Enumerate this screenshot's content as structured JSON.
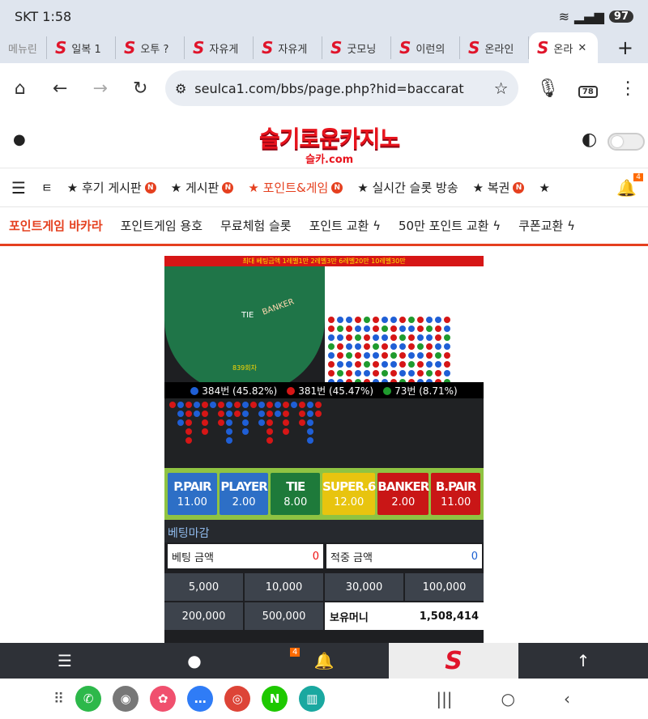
{
  "status": {
    "time": "SKT 1:58",
    "battery": "97"
  },
  "tabs": [
    {
      "label": "메뉴린"
    },
    {
      "label": "일복 1"
    },
    {
      "label": "오투 ?"
    },
    {
      "label": "자유게"
    },
    {
      "label": "자유게"
    },
    {
      "label": "굿모닝"
    },
    {
      "label": "이런의"
    },
    {
      "label": "온라인"
    },
    {
      "label": "온라"
    }
  ],
  "browser": {
    "url": "seulca1.com/bbs/page.php?hid=baccarat",
    "tab_count": "78"
  },
  "site": {
    "logo_main": "슬기로운카지노",
    "logo_sub": "슬카.com"
  },
  "menu1": [
    {
      "label": "ㅌ"
    },
    {
      "label": "★ 후기 게시판"
    },
    {
      "label": "★ 게시판"
    },
    {
      "label": "★ 포인트&게임"
    },
    {
      "label": "★ 실시간 슬롯 방송"
    },
    {
      "label": "★ 복권"
    },
    {
      "label": "★"
    }
  ],
  "bell_count": "4",
  "menu2": [
    {
      "label": "포인트게임 바카라"
    },
    {
      "label": "포인트게임 용호"
    },
    {
      "label": "무료체험 슬롯"
    },
    {
      "label": "포인트 교환 ϟ"
    },
    {
      "label": "50만 포인트 교환 ϟ"
    },
    {
      "label": "쿠폰교환 ϟ"
    }
  ],
  "game": {
    "banner": "최대 베팅금액   1레벨1만 2레벨3만 6레벨20만 10레벨30만",
    "table_banker": "BANKER",
    "table_tie": "TIE",
    "round_label": "839회차",
    "counts": [
      {
        "label": "384번 (45.82%)",
        "color": "#1f5fd6"
      },
      {
        "label": "381번 (45.47%)",
        "color": "#d61616"
      },
      {
        "label": "73번 (8.71%)",
        "color": "#1f9b2e"
      }
    ],
    "bets": [
      {
        "name": "P.PAIR",
        "odds": "11.00",
        "color": "#2d6fc6"
      },
      {
        "name": "PLAYER",
        "odds": "2.00",
        "color": "#2d6fc6"
      },
      {
        "name": "TIE",
        "odds": "8.00",
        "color": "#1e7a3a"
      },
      {
        "name": "SUPER.6",
        "odds": "12.00",
        "color": "#e8c40f"
      },
      {
        "name": "BANKER",
        "odds": "2.00",
        "color": "#c91616"
      },
      {
        "name": "B.PAIR",
        "odds": "11.00",
        "color": "#c91616"
      }
    ],
    "bet_close": "베팅마감",
    "bet_amount_label": "베팅 금액",
    "bet_amount_value": "0",
    "win_amount_label": "적중 금액",
    "win_amount_value": "0",
    "chips": [
      "5,000",
      "10,000",
      "30,000",
      "100,000",
      "200,000",
      "500,000"
    ],
    "money_label": "보유머니",
    "money_value": "1,508,414"
  },
  "bottom_nav_badge": "4"
}
